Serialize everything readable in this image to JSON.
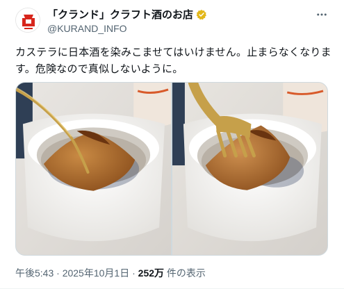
{
  "author": {
    "display_name": "「クランド」クラフト酒のお店",
    "handle": "@KURAND_INFO",
    "avatar_icon": "kurand-logo-icon",
    "badge_icon": "verified-gold-badge-icon"
  },
  "tweet": {
    "text": "カステラに日本酒を染みこませてはいけません。止まらなくなります。危険なので真似しないように。",
    "time": "午後5:43",
    "date": "2025年10月1日",
    "views_count": "252万",
    "views_label": "件の表示",
    "separator": "·"
  },
  "icons": {
    "more": "more-dots-icon"
  },
  "media": [
    {
      "name": "photo-castella-spoon",
      "utensil": "spoon"
    },
    {
      "name": "photo-castella-fork",
      "utensil": "fork"
    }
  ],
  "colors": {
    "text": "#0f1419",
    "secondary": "#536471",
    "brand_red": "#d7261c",
    "verified_gold": "#e2b719"
  }
}
